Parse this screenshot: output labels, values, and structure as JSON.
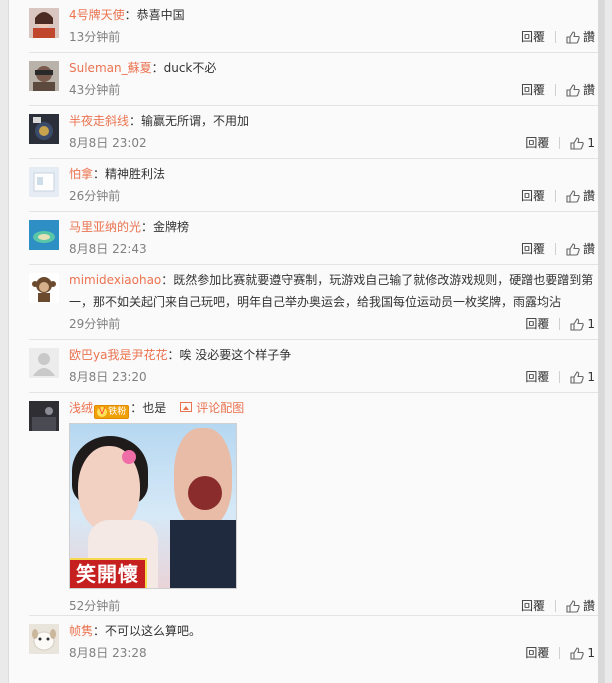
{
  "labels": {
    "reply": "回覆",
    "like": "讚"
  },
  "comments": [
    {
      "user": "4号牌天使",
      "text": "：恭喜中国",
      "time": "13分钟前",
      "likes": "",
      "avatar": "avatar-girl"
    },
    {
      "user": "Suleman_蘇夏",
      "text": "：duck不必",
      "time": "43分钟前",
      "likes": "",
      "avatar": "avatar-person"
    },
    {
      "user": "半夜走斜线",
      "text": "：输赢无所谓，不用加",
      "time": "8月8日 23:02",
      "likes": "1",
      "avatar": "avatar-object"
    },
    {
      "user": "怕拿",
      "text": "：精神胜利法",
      "time": "26分钟前",
      "likes": "",
      "avatar": "avatar-white"
    },
    {
      "user": "马里亚纳的光",
      "text": "：金牌榜",
      "time": "8月8日 22:43",
      "likes": "",
      "avatar": "avatar-sea"
    },
    {
      "user": "mimidexiaohao",
      "text": "：既然参加比赛就要遵守赛制，玩游戏自己输了就修改游戏规则，硬蹭也要蹭到第一，那不如关起门来自己玩吧，明年自己举办奥运会，给我国每位运动员一枚奖牌，雨露均沾",
      "time": "29分钟前",
      "likes": "1",
      "avatar": "avatar-monkey"
    },
    {
      "user": "欧巴ya我是尹花花",
      "text": "：唉 没必要这个样子争",
      "time": "8月8日 23:20",
      "likes": "1",
      "avatar": "avatar-default"
    },
    {
      "user": "浅绒",
      "badge": "铁粉",
      "text": "：也是",
      "pic_link": "评论配图",
      "image_caption": "笑開懷",
      "time": "52分钟前",
      "likes": "",
      "avatar": "avatar-dark"
    },
    {
      "user": "帧隽",
      "text": "：不可以这么算吧。",
      "time": "8月8日 23:28",
      "likes": "1",
      "avatar": "avatar-dog"
    }
  ]
}
